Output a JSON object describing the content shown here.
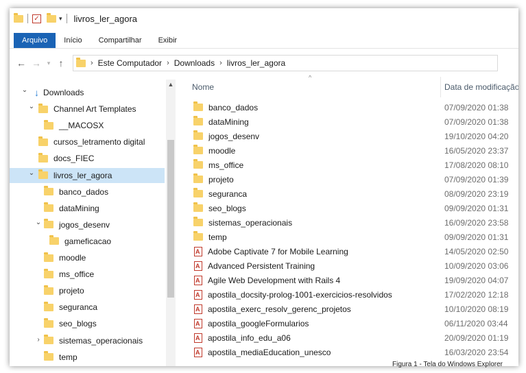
{
  "titlebar": {
    "title": "livros_ler_agora"
  },
  "ribbon": {
    "tabs": [
      "Arquivo",
      "Início",
      "Compartilhar",
      "Exibir"
    ]
  },
  "address": {
    "crumbs": [
      "Este Computador",
      "Downloads",
      "livros_ler_agora"
    ]
  },
  "navpane": {
    "items": [
      {
        "label": "Downloads",
        "chev": "expanded",
        "type": "downloads"
      },
      {
        "label": "Channel Art Templates",
        "chev": "expanded",
        "type": "folder"
      },
      {
        "label": "__MACOSX",
        "chev": "",
        "type": "folder"
      },
      {
        "label": "cursos_letramento digital",
        "chev": "",
        "type": "folder"
      },
      {
        "label": "docs_FIEC",
        "chev": "",
        "type": "folder"
      },
      {
        "label": "livros_ler_agora",
        "chev": "expanded",
        "type": "folder",
        "selected": true
      },
      {
        "label": "banco_dados",
        "chev": "",
        "type": "folder"
      },
      {
        "label": "dataMining",
        "chev": "",
        "type": "folder"
      },
      {
        "label": "jogos_desenv",
        "chev": "expanded",
        "type": "folder"
      },
      {
        "label": "gameficacao",
        "chev": "",
        "type": "folder"
      },
      {
        "label": "moodle",
        "chev": "",
        "type": "folder"
      },
      {
        "label": "ms_office",
        "chev": "",
        "type": "folder"
      },
      {
        "label": "projeto",
        "chev": "",
        "type": "folder"
      },
      {
        "label": "seguranca",
        "chev": "",
        "type": "folder"
      },
      {
        "label": "seo_blogs",
        "chev": "",
        "type": "folder"
      },
      {
        "label": "sistemas_operacionais",
        "chev": "collapsed",
        "type": "folder"
      },
      {
        "label": "temp",
        "chev": "",
        "type": "folder"
      }
    ]
  },
  "columns": {
    "name": "Nome",
    "date": "Data de modificação"
  },
  "files": [
    {
      "name": "banco_dados",
      "date": "07/09/2020 01:38",
      "type": "folder"
    },
    {
      "name": "dataMining",
      "date": "07/09/2020 01:38",
      "type": "folder"
    },
    {
      "name": "jogos_desenv",
      "date": "19/10/2020 04:20",
      "type": "folder"
    },
    {
      "name": "moodle",
      "date": "16/05/2020 23:37",
      "type": "folder"
    },
    {
      "name": "ms_office",
      "date": "17/08/2020 08:10",
      "type": "folder"
    },
    {
      "name": "projeto",
      "date": "07/09/2020 01:39",
      "type": "folder"
    },
    {
      "name": "seguranca",
      "date": "08/09/2020 23:19",
      "type": "folder"
    },
    {
      "name": "seo_blogs",
      "date": "09/09/2020 01:31",
      "type": "folder"
    },
    {
      "name": "sistemas_operacionais",
      "date": "16/09/2020 23:58",
      "type": "folder"
    },
    {
      "name": "temp",
      "date": "09/09/2020 01:31",
      "type": "folder"
    },
    {
      "name": "Adobe Captivate 7 for Mobile Learning",
      "date": "14/05/2020 02:50",
      "type": "pdf"
    },
    {
      "name": "Advanced Persistent Training",
      "date": "10/09/2020 03:06",
      "type": "pdf"
    },
    {
      "name": "Agile Web Development with Rails 4",
      "date": "19/09/2020 04:07",
      "type": "pdf"
    },
    {
      "name": "apostila_docsity-prolog-1001-exercicios-resolvidos",
      "date": "17/02/2020 12:18",
      "type": "pdf"
    },
    {
      "name": "apostila_exerc_resolv_gerenc_projetos",
      "date": "10/10/2020 08:19",
      "type": "pdf"
    },
    {
      "name": "apostila_googleFormularios",
      "date": "06/11/2020 03:44",
      "type": "pdf"
    },
    {
      "name": "apostila_info_edu_a06",
      "date": "20/09/2020 01:19",
      "type": "pdf"
    },
    {
      "name": "apostila_mediaEducation_unesco",
      "date": "16/03/2020 23:54",
      "type": "pdf"
    }
  ],
  "caption": "Figura 1 - Tela do Windows Explorer",
  "colors": {
    "accent": "#1a63b5",
    "selection": "#cce4f7",
    "folder": "#f8d26a",
    "pdf": "#c0392b"
  },
  "icons": [
    "folder-icon",
    "pdf-icon",
    "downloads-icon",
    "back-icon",
    "forward-icon",
    "up-icon"
  ]
}
